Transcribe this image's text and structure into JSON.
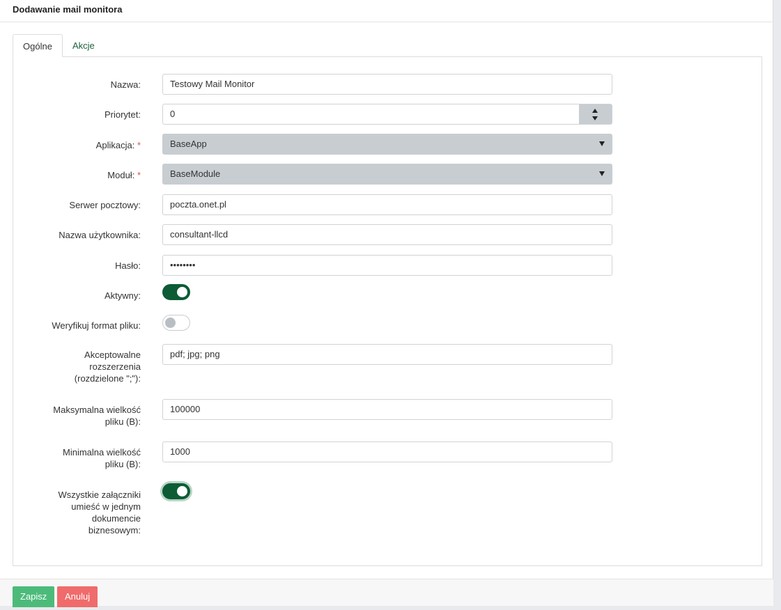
{
  "header": {
    "title": "Dodawanie mail monitora"
  },
  "tabs": [
    {
      "label": "Ogólne",
      "active": true
    },
    {
      "label": "Akcje",
      "active": false
    }
  ],
  "form": {
    "name": {
      "label": "Nazwa:",
      "value": "Testowy Mail Monitor"
    },
    "priority": {
      "label": "Priorytet:",
      "value": "0"
    },
    "application": {
      "label": "Aplikacja:",
      "required_mark": "*",
      "value": "BaseApp"
    },
    "module": {
      "label": "Moduł:",
      "required_mark": "*",
      "value": "BaseModule"
    },
    "mail_server": {
      "label": "Serwer pocztowy:",
      "value": "poczta.onet.pl"
    },
    "username": {
      "label": "Nazwa użytkownika:",
      "value": "consultant-llcd"
    },
    "password": {
      "label": "Hasło:",
      "value": "••••••••"
    },
    "active": {
      "label": "Aktywny:",
      "checked": true
    },
    "verify_format": {
      "label": "Weryfikuj format pliku:",
      "checked": false
    },
    "extensions": {
      "label_lines": [
        "Akceptowalne",
        "rozszerzenia",
        "(rozdzielone \";\"):"
      ],
      "value": "pdf; jpg; png"
    },
    "max_size": {
      "label_lines": [
        "Maksymalna wielkość",
        "pliku (B):"
      ],
      "value": "100000"
    },
    "min_size": {
      "label_lines": [
        "Minimalna wielkość",
        "pliku (B):"
      ],
      "value": "1000"
    },
    "single_document": {
      "label_lines": [
        "Wszystkie załączniki",
        "umieść w jednym",
        "dokumencie",
        "biznesowym:"
      ],
      "checked": true
    }
  },
  "footer": {
    "save_label": "Zapisz",
    "cancel_label": "Anuluj"
  },
  "colors": {
    "accent": "#0d5c35",
    "save": "#4cbb7a",
    "cancel": "#f06b6b",
    "select_bg": "#c8cdd2",
    "required": "#d9534f"
  }
}
